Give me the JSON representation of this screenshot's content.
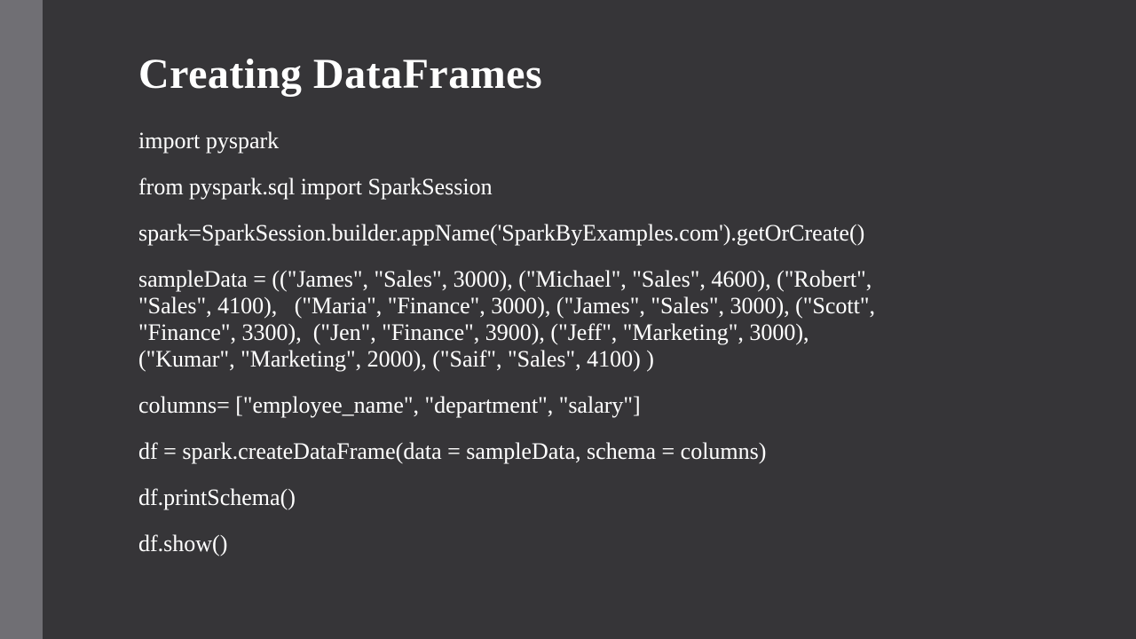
{
  "slide": {
    "title": "Creating DataFrames",
    "lines": [
      "import pyspark",
      "from pyspark.sql import SparkSession",
      "spark=SparkSession.builder.appName('SparkByExamples.com').getOrCreate()"
    ],
    "sample_data_lines": [
      "sampleData = ((\"James\", \"Sales\", 3000), (\"Michael\", \"Sales\", 4600), (\"Robert\",",
      "\"Sales\", 4100),   (\"Maria\", \"Finance\", 3000), (\"James\", \"Sales\", 3000), (\"Scott\",",
      "\"Finance\", 3300),  (\"Jen\", \"Finance\", 3900), (\"Jeff\", \"Marketing\", 3000),",
      "(\"Kumar\", \"Marketing\", 2000), (\"Saif\", \"Sales\", 4100) )"
    ],
    "after_lines": [
      "columns= [\"employee_name\", \"department\", \"salary\"]",
      "df = spark.createDataFrame(data = sampleData, schema = columns)",
      "df.printSchema()",
      "df.show()"
    ]
  }
}
